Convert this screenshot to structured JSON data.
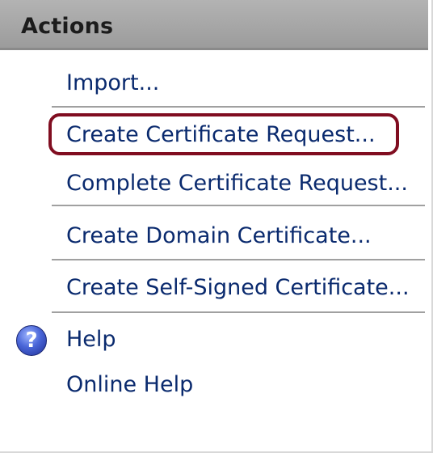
{
  "panel": {
    "title": "Actions"
  },
  "actions": {
    "import": "Import...",
    "create_request": "Create Certificate Request...",
    "complete_request": "Complete Certificate Request...",
    "create_domain": "Create Domain Certificate...",
    "create_self_signed": "Create Self-Signed Certificate...",
    "help": "Help",
    "online_help": "Online Help"
  },
  "icons": {
    "help": "help-icon",
    "help_glyph": "?"
  },
  "colors": {
    "link": "#0a2a6e",
    "header": "#a5a5a5",
    "highlight": "#800d20"
  }
}
